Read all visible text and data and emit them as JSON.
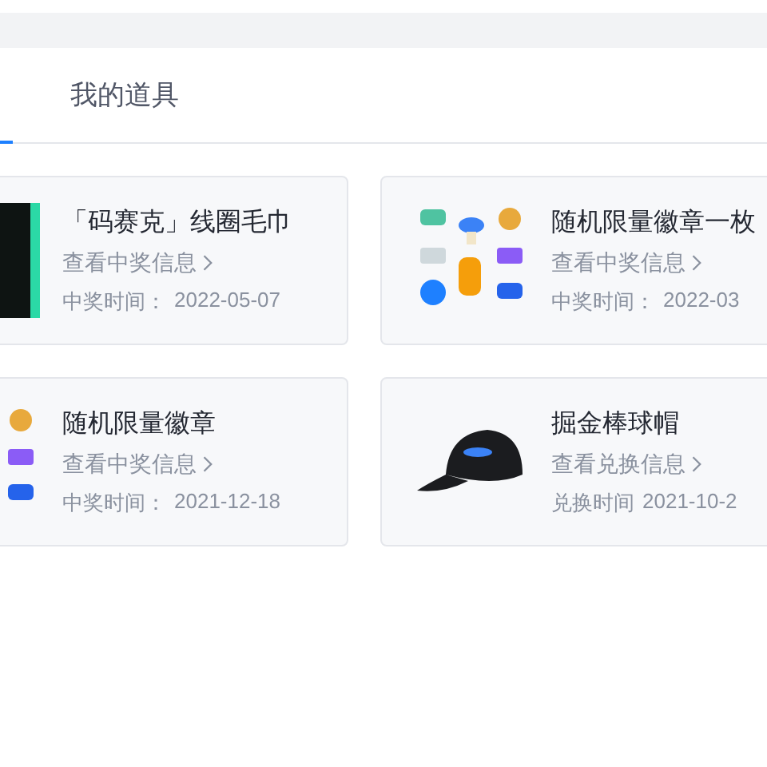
{
  "tabs": [
    {
      "selected": true
    },
    {
      "label": "我的道具",
      "selected": false
    }
  ],
  "cards": [
    {
      "kind": "photo",
      "title": "「码赛克」线圈毛巾",
      "link": "查看中奖信息",
      "time_label": "中奖时间：",
      "time": "2022-05-07"
    },
    {
      "kind": "badges",
      "title": "随机限量徽章一枚",
      "link": "查看中奖信息",
      "time_label": "中奖时间：",
      "time": "2022-03"
    },
    {
      "kind": "badges",
      "title": "随机限量徽章",
      "link": "查看中奖信息",
      "time_label": "中奖时间：",
      "time": "2021-12-18"
    },
    {
      "kind": "cap",
      "title": "掘金棒球帽",
      "link": "查看兑换信息",
      "time_label": "兑换时间",
      "time": "2021-10-2"
    }
  ]
}
